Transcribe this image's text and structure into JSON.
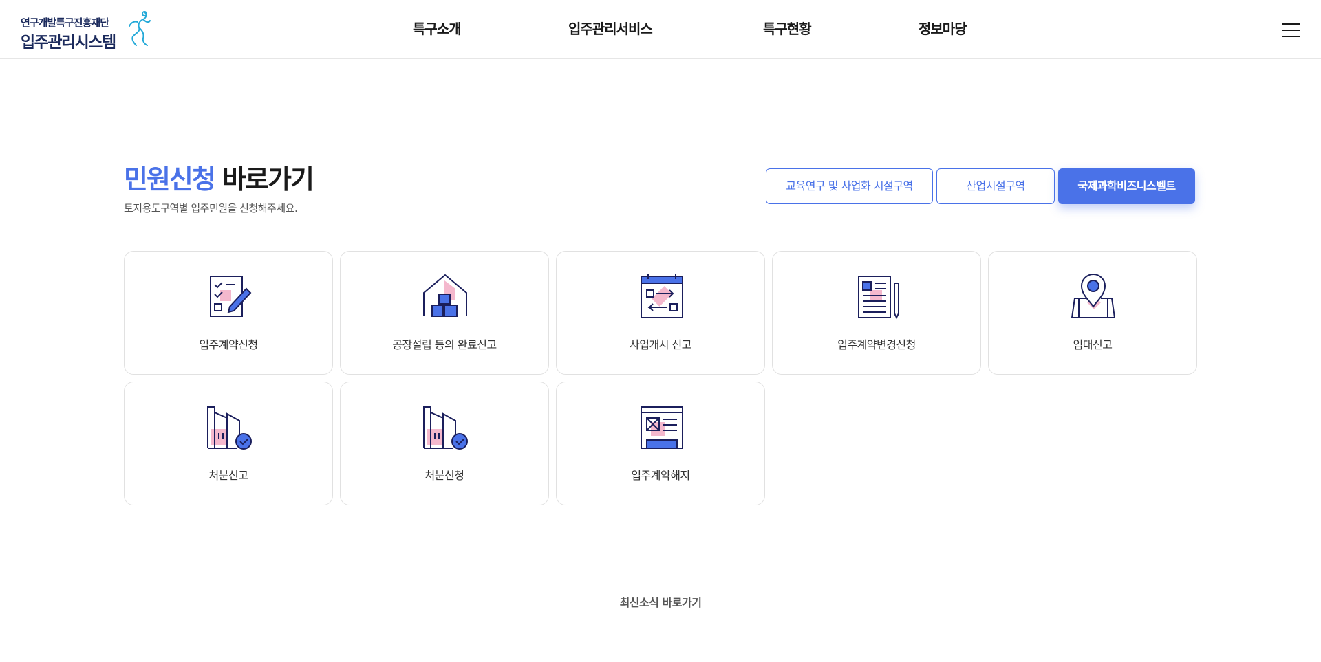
{
  "header": {
    "logo_top": "연구개발특구진흥재단",
    "logo_main": "입주관리시스템",
    "nav": [
      "특구소개",
      "입주관리서비스",
      "특구현황",
      "정보마당"
    ]
  },
  "section": {
    "title_highlight": "민원신청",
    "title_rest": "바로가기",
    "subtitle": "토지용도구역별 입주민원을 신청해주세요."
  },
  "zone_tabs": [
    "교육연구 및 사업화 시설구역",
    "산업시설구역",
    "국제과학비즈니스벨트"
  ],
  "active_tab": "국제과학비즈니스벨트",
  "cards": [
    {
      "label": "입주계약신청",
      "icon": "checklist-pen-icon"
    },
    {
      "label": "공장설립 등의 완료신고",
      "icon": "factory-boxes-icon"
    },
    {
      "label": "사업개시 신고",
      "icon": "calendar-exchange-icon"
    },
    {
      "label": "입주계약변경신청",
      "icon": "document-pencil-icon"
    },
    {
      "label": "임대신고",
      "icon": "location-pin-icon"
    },
    {
      "label": "처분신고",
      "icon": "building-check-icon"
    },
    {
      "label": "처분신청",
      "icon": "building-check-icon"
    },
    {
      "label": "입주계약해지",
      "icon": "contract-cancel-icon"
    }
  ],
  "news_link": "최신소식 바로가기",
  "colors": {
    "accent": "#4a72e8",
    "icon_line": "#1b1f5c",
    "icon_pink": "#f4b8cd"
  }
}
